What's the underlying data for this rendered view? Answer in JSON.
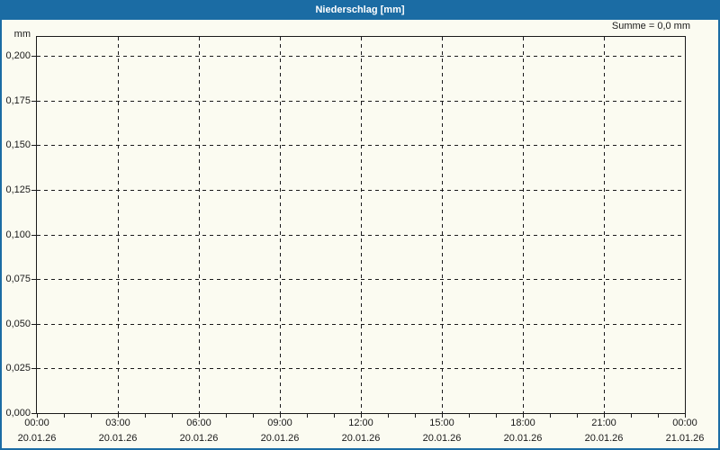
{
  "window": {
    "title": "Niederschlag [mm]"
  },
  "chart_data": {
    "type": "line",
    "title": "Niederschlag [mm]",
    "unit_label": "mm",
    "sum_label": "Summe = 0,0 mm",
    "sum_value_mm": "0,0",
    "ylabel": "mm",
    "ylim": [
      0.0,
      0.2
    ],
    "y_tick_step": 0.025,
    "y_ticks": [
      "0,200",
      "0,175",
      "0,150",
      "0,125",
      "0,100",
      "0,075",
      "0,050",
      "0,025",
      "0,000"
    ],
    "x_ticks": [
      {
        "time": "00:00",
        "date": "20.01.26"
      },
      {
        "time": "03:00",
        "date": "20.01.26"
      },
      {
        "time": "06:00",
        "date": "20.01.26"
      },
      {
        "time": "09:00",
        "date": "20.01.26"
      },
      {
        "time": "12:00",
        "date": "20.01.26"
      },
      {
        "time": "15:00",
        "date": "20.01.26"
      },
      {
        "time": "18:00",
        "date": "20.01.26"
      },
      {
        "time": "21:00",
        "date": "20.01.26"
      },
      {
        "time": "00:00",
        "date": "21.01.26"
      }
    ],
    "grid": "dashed",
    "legend": "none",
    "series": []
  },
  "colors": {
    "accent_blue": "#1b6ca4",
    "background": "#fbfbf1",
    "grid": "#1a1a1a"
  }
}
